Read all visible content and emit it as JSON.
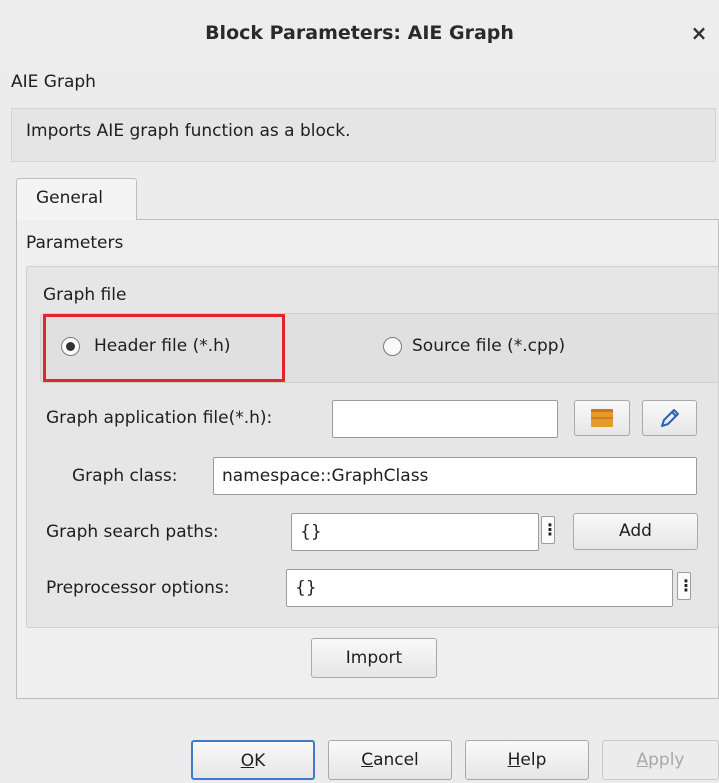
{
  "window": {
    "title": "Block Parameters: AIE Graph",
    "close_glyph": "×"
  },
  "block": {
    "name": "AIE Graph",
    "description": "Imports AIE graph function as a block."
  },
  "tabs": [
    {
      "label": "General",
      "selected": true
    }
  ],
  "parameters": {
    "section_label": "Parameters",
    "graph_file": {
      "label": "Graph file",
      "options": [
        {
          "label": "Header file (*.h)",
          "selected": true
        },
        {
          "label": "Source file (*.cpp)",
          "selected": false
        }
      ]
    },
    "application_file": {
      "label": "Graph application file(*.h):",
      "value": "",
      "browse_icon": "folder-icon",
      "edit_icon": "pencil-icon"
    },
    "graph_class": {
      "label": "Graph class:",
      "value": "namespace::GraphClass"
    },
    "search_paths": {
      "label": "Graph search paths:",
      "value": "{}",
      "menu_glyph": "⋮",
      "add_label": "Add"
    },
    "preprocessor": {
      "label": "Preprocessor options:",
      "value": "{}",
      "menu_glyph": "⋮"
    },
    "import_label": "Import"
  },
  "buttons": {
    "ok": {
      "prefix": "",
      "mnemonic": "O",
      "rest": "K"
    },
    "cancel": {
      "prefix": "",
      "mnemonic": "C",
      "rest": "ancel"
    },
    "help": {
      "prefix": "",
      "mnemonic": "H",
      "rest": "elp"
    },
    "apply": {
      "prefix": "",
      "mnemonic": "A",
      "rest": "pply",
      "enabled": false
    }
  },
  "colors": {
    "highlight": "#e3242b",
    "ok_border": "#3d7cc9",
    "folder": "#e59a2c",
    "pencil": "#2a63b6"
  }
}
